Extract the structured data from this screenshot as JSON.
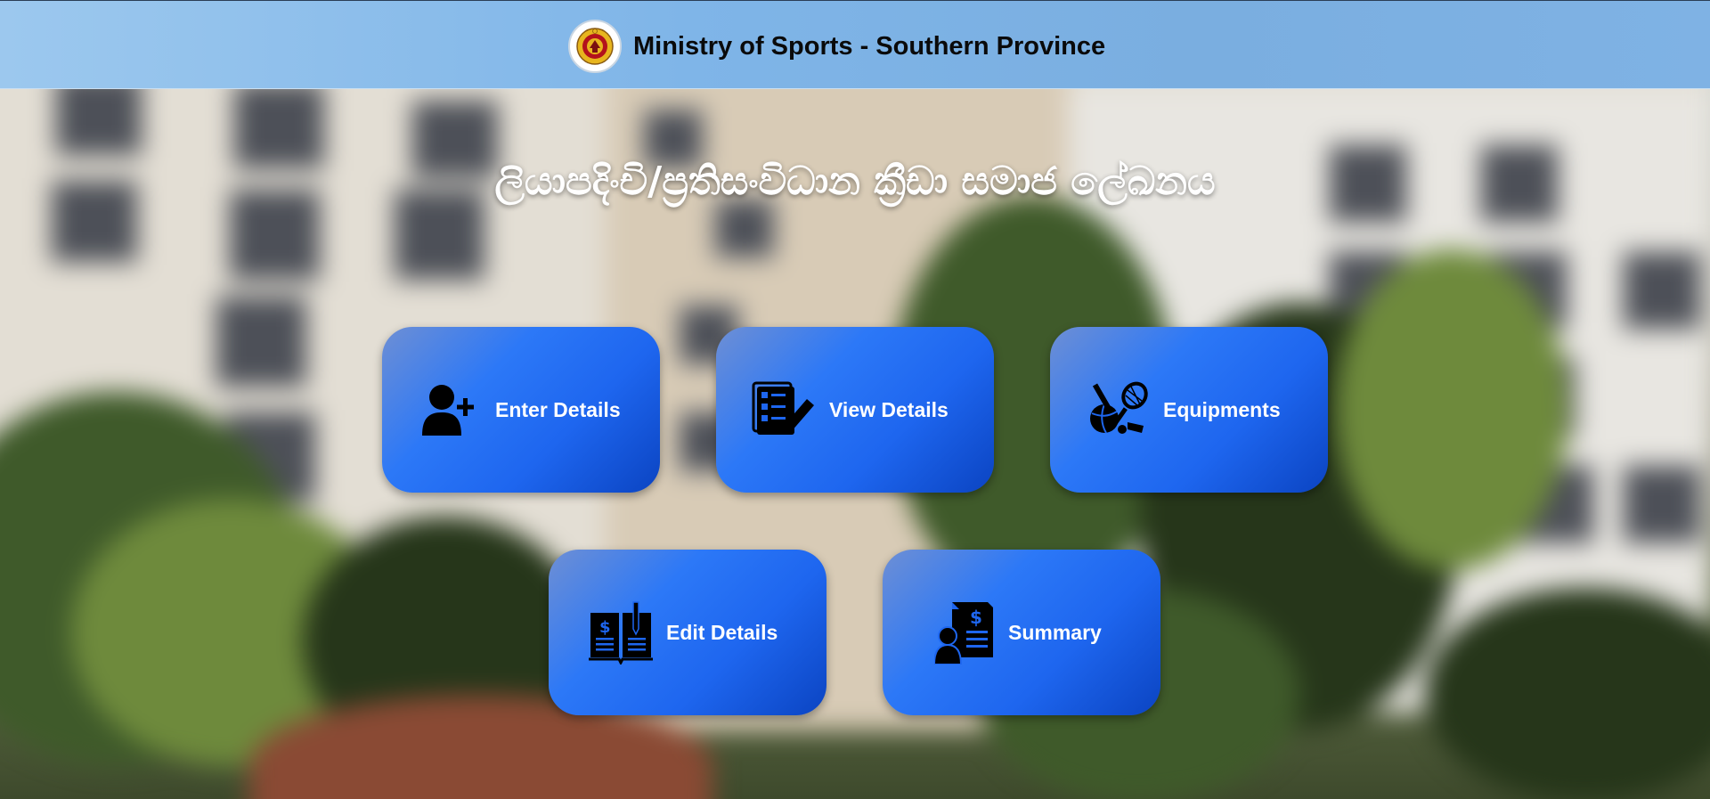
{
  "header": {
    "emblem_icon": "sri-lanka-emblem-icon",
    "title": "Ministry of Sports - Southern Province"
  },
  "main": {
    "title": "ලියාපදිංචි/ප්‍රතිසංවිධාන ක්‍රීඩා සමාජ ලේඛනය",
    "tiles": [
      {
        "label": "Enter Details",
        "icon": "add-user-icon"
      },
      {
        "label": "View Details",
        "icon": "checklist-pencil-icon"
      },
      {
        "label": "Equipments",
        "icon": "sports-equipment-icon"
      },
      {
        "label": "Edit Details",
        "icon": "ledger-book-icon"
      },
      {
        "label": "Summary",
        "icon": "invoice-person-icon"
      }
    ]
  },
  "colors": {
    "header": "#7fb5e8",
    "tile_start": "#6e8fd4",
    "tile_mid": "#2c78f7",
    "tile_end": "#0b44c2",
    "tile_text": "#ffffff",
    "title_text": "#ffffff"
  }
}
